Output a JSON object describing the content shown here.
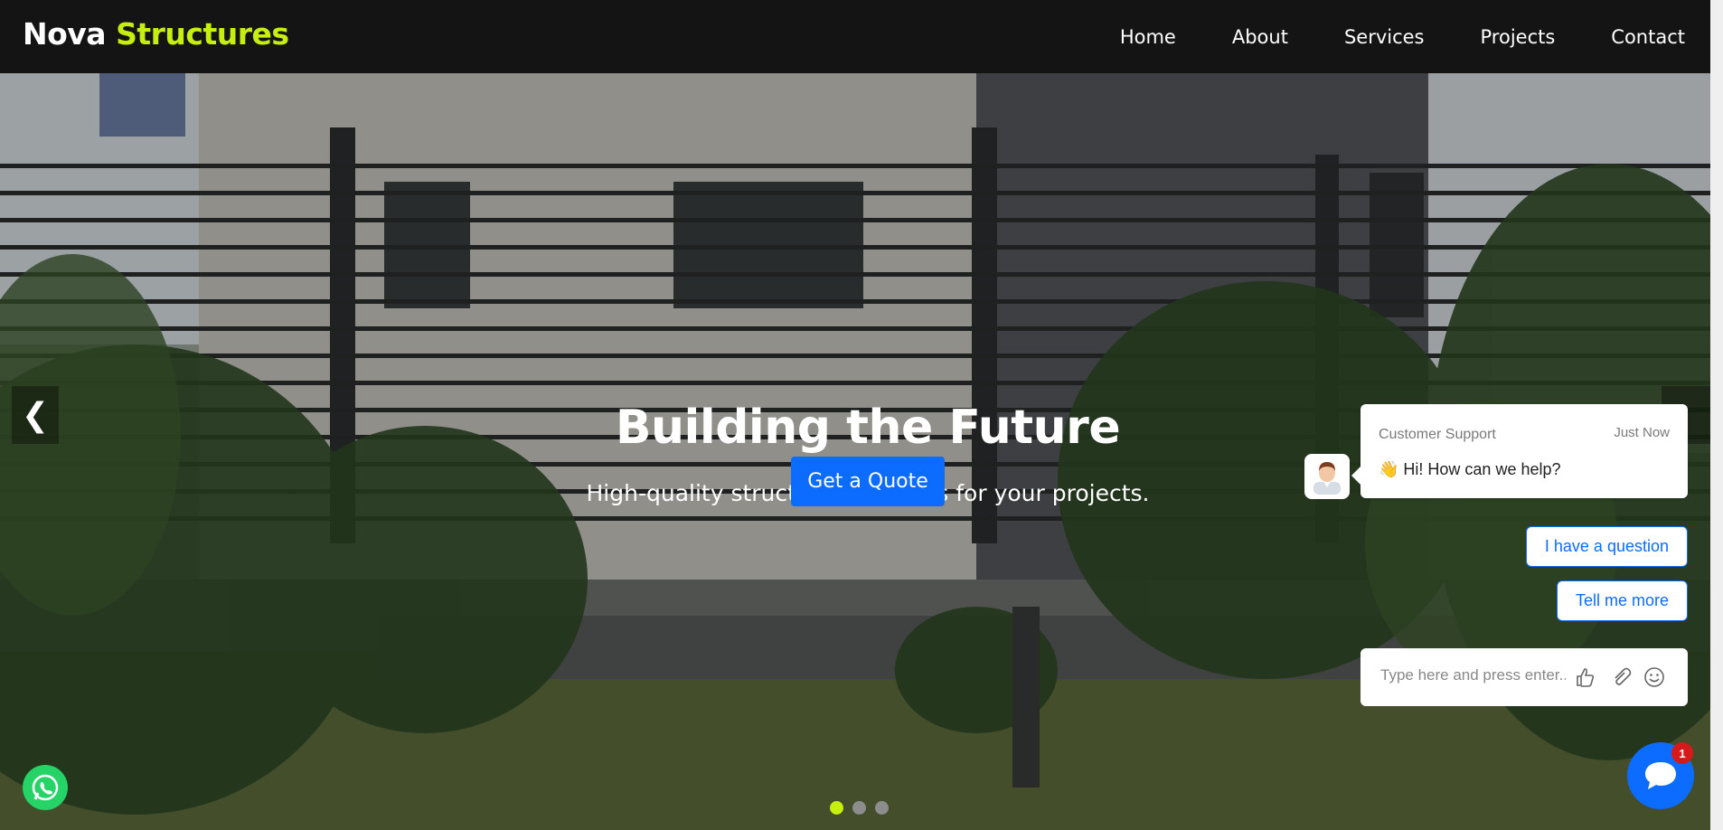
{
  "brand": {
    "part1": "Nova",
    "part2": "Structures"
  },
  "nav": {
    "items": [
      "Home",
      "About",
      "Services",
      "Projects",
      "Contact"
    ]
  },
  "hero": {
    "title": "Building the Future",
    "subtitle": "High-quality structural solutions for your projects.",
    "cta_label": "Get a Quote",
    "prev_arrow": "❮",
    "slides_total": 3,
    "active_slide": 1
  },
  "chat": {
    "agent_name": "Customer Support",
    "time": "Just Now",
    "message": "👋 Hi! How can we help?",
    "options": [
      "I have a question",
      "Tell me more"
    ],
    "input_placeholder": "Type here and press enter..",
    "unread_count": "1"
  },
  "colors": {
    "accent": "#c6ef0f",
    "primary": "#0b6cff",
    "header": "#141414",
    "whatsapp": "#25d366",
    "badge": "#d61a1a"
  },
  "icons": [
    "whatsapp-icon",
    "thumbs-up-icon",
    "paperclip-icon",
    "smiley-icon",
    "chat-bubble-icon",
    "agent-avatar-icon"
  ]
}
